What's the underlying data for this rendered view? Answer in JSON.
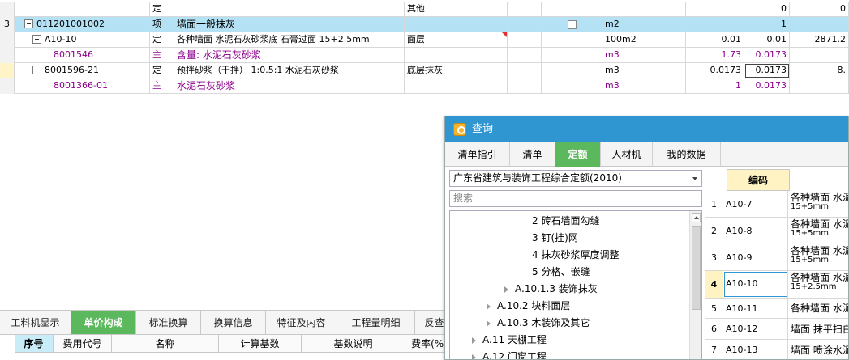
{
  "grid": {
    "rows": [
      {
        "num": "",
        "code": "",
        "type": "定",
        "name": "",
        "feature": "其他",
        "unit": "",
        "qty1": "",
        "qty2": "0",
        "price": "0"
      },
      {
        "num": "3",
        "code": "011201001002",
        "type": "项",
        "name": "墙面一般抹灰",
        "feature": "",
        "unit": "m2",
        "qty1": "",
        "qty2": "1",
        "price": ""
      },
      {
        "num": "",
        "code": "A10-10",
        "type": "定",
        "name": "各种墙面 水泥石灰砂浆底 石膏过面 15+2.5mm",
        "feature": "面层",
        "unit": "100m2",
        "qty1": "0.01",
        "qty2": "0.01",
        "price": "2871.2"
      },
      {
        "num": "",
        "code": "8001546",
        "type": "主",
        "name": "含量: 水泥石灰砂浆",
        "feature": "",
        "unit": "m3",
        "qty1": "1.73",
        "qty2": "0.0173",
        "price": ""
      },
      {
        "num": "",
        "code": "8001596-21",
        "type": "定",
        "name": "预拌砂浆（干拌） 1:0.5:1 水泥石灰砂浆",
        "feature": "底层抹灰",
        "unit": "m3",
        "qty1": "0.0173",
        "qty2": "0.0173",
        "price": "8."
      },
      {
        "num": "",
        "code": "8001366-01",
        "type": "主",
        "name": "水泥石灰砂浆",
        "feature": "",
        "unit": "m3",
        "qty1": "1",
        "qty2": "0.0173",
        "price": ""
      }
    ]
  },
  "bottom_tabs": [
    "工料机显示",
    "单价构成",
    "标准换算",
    "换算信息",
    "特征及内容",
    "工程量明细",
    "反查"
  ],
  "bottom_tab_active": "单价构成",
  "bottom_headers": [
    "序号",
    "费用代号",
    "名称",
    "计算基数",
    "基数说明",
    "费率(%)"
  ],
  "query": {
    "title": "查询",
    "tabs": [
      "清单指引",
      "清单",
      "定额",
      "人材机",
      "我的数据"
    ],
    "active_tab": "定额",
    "dropdown_value": "广东省建筑与装饰工程综合定额(2010)",
    "search_placeholder": "搜索",
    "tree": [
      {
        "label": "2 砖石墙面勾缝",
        "arrow": false
      },
      {
        "label": "3 钉(挂)网",
        "arrow": false
      },
      {
        "label": "4 抹灰砂浆厚度调整",
        "arrow": false
      },
      {
        "label": "5 分格、嵌缝",
        "arrow": false
      },
      {
        "label": "A.10.1.3 装饰抹灰",
        "arrow": true
      },
      {
        "label": "A.10.2 块料面层",
        "arrow": true
      },
      {
        "label": "A.10.3 木装饰及其它",
        "arrow": true
      },
      {
        "label": "A.11 天棚工程",
        "arrow": true
      },
      {
        "label": "A.12 门窗工程",
        "arrow": true
      }
    ],
    "grid_header": "编码",
    "grid_rows": [
      {
        "num": "1",
        "code": "A10-7",
        "desc1": "各种墙面 水泥",
        "desc2": "15+5mm"
      },
      {
        "num": "2",
        "code": "A10-8",
        "desc1": "各种墙面 水泥",
        "desc2": "15+5mm"
      },
      {
        "num": "3",
        "code": "A10-9",
        "desc1": "各种墙面 水泥",
        "desc2": "15+5mm"
      },
      {
        "num": "4",
        "code": "A10-10",
        "desc1": "各种墙面 水泥",
        "desc2": "15+2.5mm"
      },
      {
        "num": "5",
        "code": "A10-11",
        "desc1": "各种墙面 水泥",
        "desc2": ""
      },
      {
        "num": "6",
        "code": "A10-12",
        "desc1": "墙面 抹平扫白",
        "desc2": ""
      },
      {
        "num": "7",
        "code": "A10-13",
        "desc1": "墙面 喷涂水泥",
        "desc2": ""
      }
    ]
  }
}
